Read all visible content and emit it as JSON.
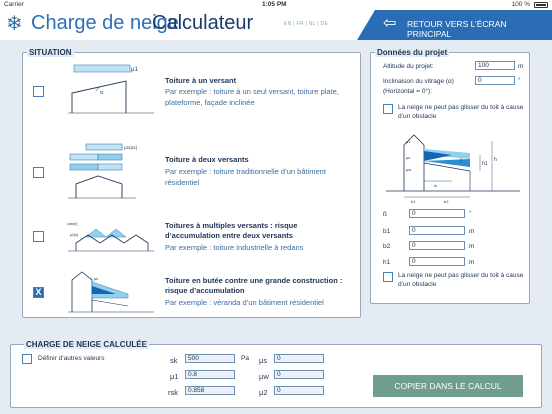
{
  "status": {
    "carrier": "Carrier",
    "time": "1:05 PM",
    "battery": "100 %"
  },
  "header": {
    "title_part1": "Charge de neige",
    "title_part2": "Calculateur",
    "languages": "EN | FR | NL | DE",
    "back_label": "RETOUR VERS L’ÉCRAN PRINCIPAL",
    "snow_icon": "snowflake-icon",
    "back_icon": "arrow-left-icon"
  },
  "situation": {
    "legend": "SITUATION",
    "items": [
      {
        "title": "Toiture à un versant",
        "description": "Par exemple : toiture à un seul versant, toiture plate, plateforme, façade inclinée",
        "checked": false,
        "thumb_label": "μ1"
      },
      {
        "title": "Toiture à deux versants",
        "description": "Par exemple : toiture traditionnelle d’un bâtiment résidentiel",
        "checked": false,
        "thumb_label": "μ1(α1)"
      },
      {
        "title": "Toitures à multiples versants : risque d’accumulation entre deux versants",
        "description": "Par exemple : toiture industrielle à redans",
        "checked": false,
        "thumb_label": "μ2(α)"
      },
      {
        "title": "Toiture en butée contre une grande construction : risque d’accumulation",
        "description": "Par exemple : véranda d’un bâtiment résidentiel",
        "checked": true,
        "thumb_label": "μs"
      }
    ]
  },
  "project": {
    "legend": "Données du projet",
    "altitude_label": "Altitude du projet:",
    "altitude_value": "100",
    "altitude_unit": "m",
    "inclination_label": "Inclinaison du vitrage (α)",
    "inclination_sub": "(Horizontal = 0°):",
    "inclination_value": "0",
    "inclination_unit": "°",
    "obstacle_label_1": "La neige ne peut pas glisser du toit à cause d’un obstacle",
    "fields": [
      {
        "label": "ß",
        "value": "0",
        "unit": "°"
      },
      {
        "label": "b1",
        "value": "0",
        "unit": "m"
      },
      {
        "label": "b2",
        "value": "0",
        "unit": "m"
      },
      {
        "label": "h1",
        "value": "0",
        "unit": "m"
      }
    ],
    "obstacle_label_2": "La neige ne peut pas glisser du toit à cause d’un obstacle",
    "diagram_labels": [
      "β",
      "h1",
      "h",
      "b1",
      "b2",
      "ls",
      "μ1",
      "μs",
      "μw"
    ]
  },
  "result": {
    "legend": "CHARGE DE NEIGE CALCULÉE",
    "define_other": "Définir d’autres valeurs",
    "sk_label": "sk",
    "sk_value": "500",
    "sk_unit": "Pa",
    "mu1_label": "μ1",
    "mu1_value": "0.8",
    "rsk_label": "rsk",
    "rsk_value": "0.858",
    "mus_label": "μs",
    "mus_value": "0",
    "muw_label": "μw",
    "muw_value": "0",
    "mu2_label": "μ2",
    "mu2_value": "0",
    "copy_button": "COPIER DANS LE CALCUL"
  }
}
